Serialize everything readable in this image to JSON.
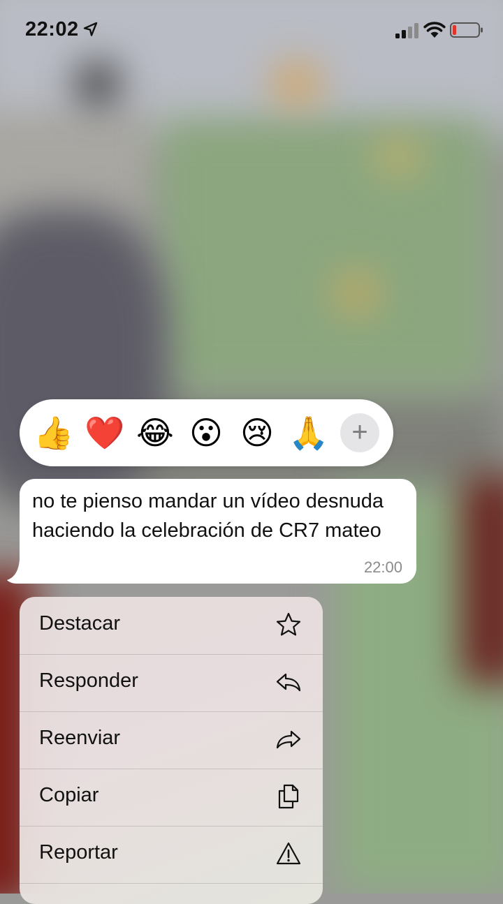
{
  "status_bar": {
    "time": "22:02"
  },
  "reactions": [
    "👍",
    "❤️",
    "😂",
    "😮",
    "😢",
    "🙏"
  ],
  "message": {
    "text": "no te pienso mandar un vídeo desnuda haciendo la celebración de CR7 mateo",
    "time": "22:00"
  },
  "menu": {
    "items": [
      {
        "label": "Destacar",
        "icon": "star-icon"
      },
      {
        "label": "Responder",
        "icon": "reply-icon"
      },
      {
        "label": "Reenviar",
        "icon": "forward-icon"
      },
      {
        "label": "Copiar",
        "icon": "copy-icon"
      },
      {
        "label": "Reportar",
        "icon": "warning-icon"
      }
    ]
  },
  "colors": {
    "bubble": "#ffffff",
    "reaction_plus_bg": "#e5e5e7",
    "battery_low": "#e0352b"
  }
}
